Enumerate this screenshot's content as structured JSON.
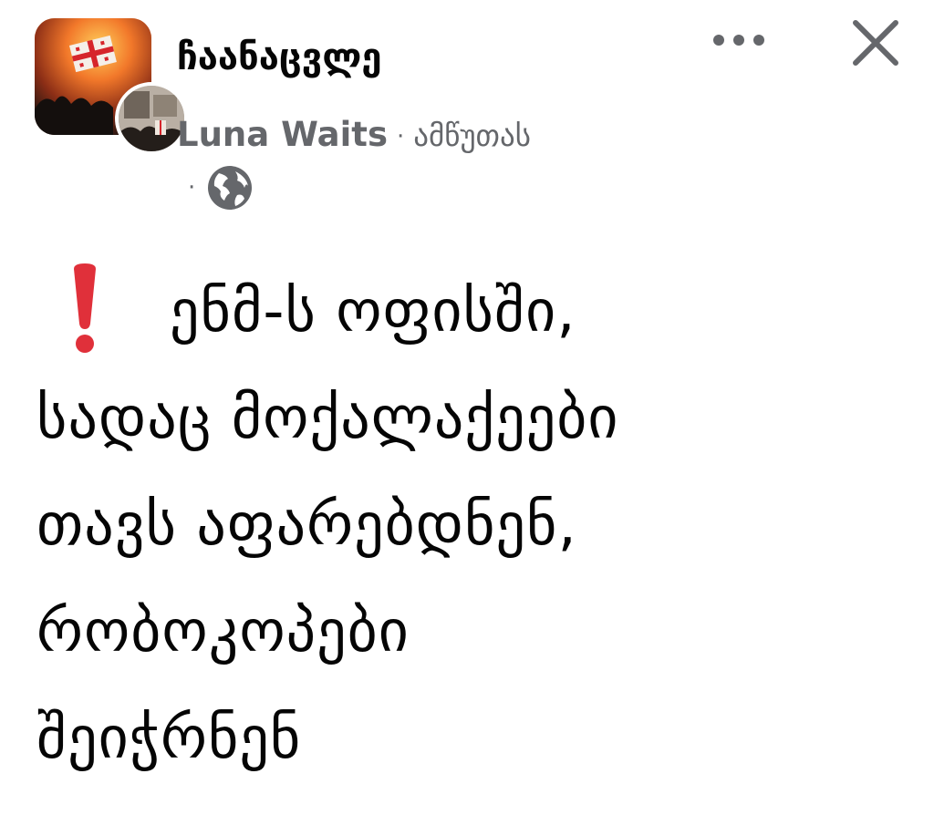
{
  "post": {
    "group_name": "ჩაანაცვლე",
    "author": "Luna Waits",
    "separator": "·",
    "timestamp": "ამწუთას",
    "privacy_separator": "·",
    "privacy_icon": "globe-icon",
    "actions": {
      "more_icon": "more-icon",
      "close_icon": "close-icon"
    },
    "body": {
      "alert_icon": "red-exclamation-icon",
      "lines": [
        "ენმ-ს ოფისში,",
        "სადაც მოქალაქეები",
        "თავს აფარებდნენ,",
        "რობოკოპები",
        "შეიჭრნენ"
      ]
    }
  },
  "colors": {
    "text_primary": "#050505",
    "text_secondary": "#65676b",
    "icon_gray": "#65676b",
    "alert_red": "#e0303a"
  }
}
